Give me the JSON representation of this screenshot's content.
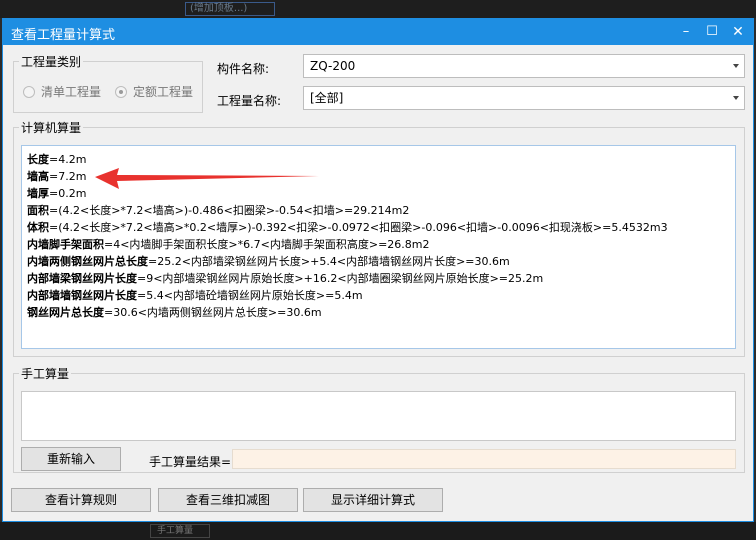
{
  "background": {
    "top_ghost": "(增加顶板...)",
    "bottom_ghost": "手工算量"
  },
  "window": {
    "title": "查看工程量计算式",
    "min": "–",
    "max": "☐",
    "close": "✕"
  },
  "quantity_type": {
    "label": "工程量类别",
    "options": [
      {
        "label": "清单工程量",
        "selected": false
      },
      {
        "label": "定额工程量",
        "selected": true
      }
    ]
  },
  "component": {
    "label": "构件名称:",
    "value": "ZQ-200"
  },
  "quantity_name": {
    "label": "工程量名称:",
    "value": "[全部]"
  },
  "computer_calc": {
    "label": "计算机算量",
    "lines": [
      {
        "key": "长度",
        "formula": "=4.2m"
      },
      {
        "key": "墙高",
        "formula": "=7.2m"
      },
      {
        "key": "墙厚",
        "formula": "=0.2m"
      },
      {
        "key": "面积",
        "formula": "=(4.2<长度>*7.2<墙高>)-0.486<扣圈梁>-0.54<扣墙>=29.214m2"
      },
      {
        "key": "体积",
        "formula": "=(4.2<长度>*7.2<墙高>*0.2<墙厚>)-0.392<扣梁>-0.0972<扣圈梁>-0.096<扣墙>-0.0096<扣现浇板>=5.4532m3"
      },
      {
        "key": "内墙脚手架面积",
        "formula": "=4<内墙脚手架面积长度>*6.7<内墙脚手架面积高度>=26.8m2"
      },
      {
        "key": "内墙两侧钢丝网片总长度",
        "formula": "=25.2<内部墙梁钢丝网片长度>+5.4<内部墙墙钢丝网片长度>=30.6m"
      },
      {
        "key": "内部墙梁钢丝网片长度",
        "formula": "=9<内部墙梁钢丝网片原始长度>+16.2<内部墙圈梁钢丝网片原始长度>=25.2m"
      },
      {
        "key": "内部墙墙钢丝网片长度",
        "formula": "=5.4<内部墙砼墙钢丝网片原始长度>=5.4m"
      },
      {
        "key": "钢丝网片总长度",
        "formula": "=30.6<内墙两侧钢丝网片总长度>=30.6m"
      }
    ]
  },
  "manual_calc": {
    "label": "手工算量",
    "reenter_button": "重新输入",
    "result_label": "手工算量结果=",
    "result_value": ""
  },
  "buttons": {
    "view_rules": "查看计算规则",
    "view_3d": "查看三维扣减图",
    "show_detail": "显示详细计算式"
  },
  "colors": {
    "titlebar": "#1e8ee2",
    "annotation_arrow": "#e8322e",
    "result_bg": "#fdf2e6"
  }
}
